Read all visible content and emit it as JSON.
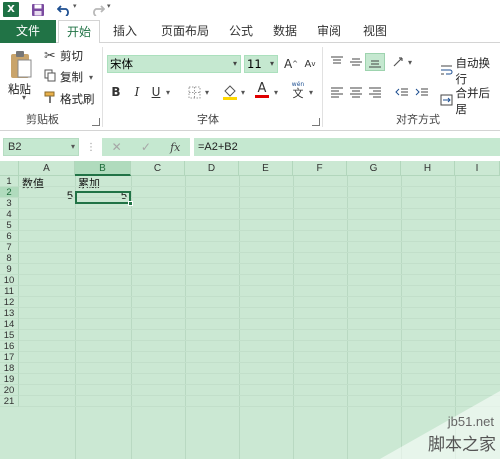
{
  "title_bar": {
    "app_icon_letter": "X",
    "undo_dropdown": "▾",
    "redo_dropdown": "▾"
  },
  "tabs": [
    {
      "label": "文件"
    },
    {
      "label": "开始"
    },
    {
      "label": "插入"
    },
    {
      "label": "页面布局"
    },
    {
      "label": "公式"
    },
    {
      "label": "数据"
    },
    {
      "label": "审阅"
    },
    {
      "label": "视图"
    }
  ],
  "ribbon": {
    "clipboard": {
      "paste_label": "粘贴",
      "cut_label": "剪切",
      "copy_label": "复制",
      "format_painter_label": "格式刷",
      "group_label": "剪贴板"
    },
    "font": {
      "font_name": "宋体",
      "font_size": "11",
      "grow_font": "A",
      "shrink_font": "A",
      "bold": "B",
      "italic": "I",
      "underline": "U",
      "font_color_letter": "A",
      "phonetic": "wén",
      "phonetic_char": "文",
      "group_label": "字体"
    },
    "alignment": {
      "wrap_text_label": "自动换行",
      "merge_label": "合并后居",
      "group_label": "对齐方式"
    },
    "colors": {
      "accent": "#217346",
      "fill_yellow": "#ffd800",
      "font_red": "#e00000"
    }
  },
  "formula_bar": {
    "name_box": "B2",
    "cancel_icon": "✕",
    "enter_icon": "✓",
    "fx_label": "fx",
    "formula": "=A2+B2"
  },
  "sheet": {
    "columns": [
      "A",
      "B",
      "C",
      "D",
      "E",
      "F",
      "G",
      "H",
      "I"
    ],
    "rows": [
      "1",
      "2",
      "3",
      "4",
      "5",
      "6",
      "7",
      "8",
      "9",
      "10",
      "11",
      "12",
      "13",
      "14",
      "15",
      "16",
      "17",
      "18",
      "19",
      "20",
      "21"
    ],
    "cells": {
      "A1": "数值",
      "B1": "累加",
      "A2": "5",
      "B2": "5"
    },
    "selected_cell": "B2"
  },
  "watermark": {
    "site": "jb51.net",
    "name": "脚本之家"
  }
}
